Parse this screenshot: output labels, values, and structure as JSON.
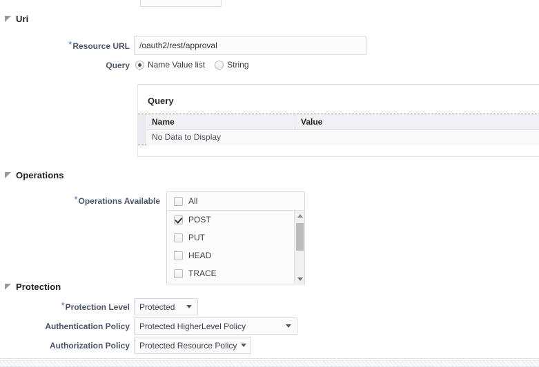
{
  "top_partial_control": {
    "value": "",
    "icon": "chevron-down-icon"
  },
  "sections": {
    "uri": {
      "title": "Uri",
      "resource_url": {
        "label": "Resource URL",
        "required_marker": "*",
        "value": "/oauth2/rest/approval",
        "placeholder": ""
      },
      "query_type": {
        "label": "Query",
        "options": [
          {
            "label": "Name Value list",
            "selected": true
          },
          {
            "label": "String",
            "selected": false
          }
        ]
      },
      "query_panel": {
        "title": "Query",
        "columns": [
          "Name",
          "Value"
        ],
        "rows": [],
        "empty_text": "No Data to Display"
      }
    },
    "operations": {
      "title": "Operations",
      "operations_available": {
        "label": "Operations Available",
        "required_marker": "*",
        "all_option": {
          "label": "All",
          "checked": false
        },
        "items": [
          {
            "label": "POST",
            "checked": true
          },
          {
            "label": "PUT",
            "checked": false
          },
          {
            "label": "HEAD",
            "checked": false
          },
          {
            "label": "TRACE",
            "checked": false
          }
        ]
      }
    },
    "protection": {
      "title": "Protection",
      "fields": [
        {
          "label": "Protection Level",
          "required_marker": "*",
          "value": "Protected",
          "icon": "chevron-down-icon"
        },
        {
          "label": "Authentication Policy",
          "required_marker": "",
          "value": "Protected HigherLevel Policy",
          "icon": "chevron-down-icon"
        },
        {
          "label": "Authorization Policy",
          "required_marker": "",
          "value": "Protected Resource Policy",
          "icon": "chevron-down-icon"
        }
      ]
    }
  },
  "colors": {
    "required_star": "#3a72b8",
    "label_text": "#4a5568",
    "section_title": "#1f1f1f",
    "input_border": "#d4dae0",
    "input_bg": "#fbfcfd",
    "table_header_bg": "#f0f2f5",
    "scroll_thumb": "#bcbcbc"
  }
}
